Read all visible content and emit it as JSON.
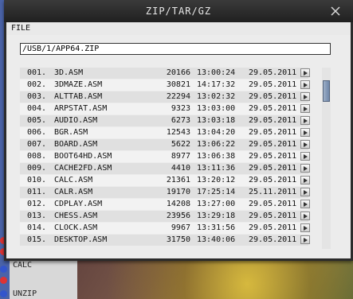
{
  "window": {
    "title": "ZIP/TAR/GZ"
  },
  "menu": {
    "file_label": "FILE"
  },
  "path": {
    "value": "/USB/1/APP64.ZIP"
  },
  "files": [
    {
      "num": "001.",
      "name": "3D.ASM",
      "size": "20166",
      "time": "13:00:24",
      "date": "29.05.2011"
    },
    {
      "num": "002.",
      "name": "3DMAZE.ASM",
      "size": "30821",
      "time": "14:17:32",
      "date": "29.05.2011"
    },
    {
      "num": "003.",
      "name": "ALTTAB.ASM",
      "size": "22294",
      "time": "13:02:32",
      "date": "29.05.2011"
    },
    {
      "num": "004.",
      "name": "ARPSTAT.ASM",
      "size": "9323",
      "time": "13:03:00",
      "date": "29.05.2011"
    },
    {
      "num": "005.",
      "name": "AUDIO.ASM",
      "size": "6273",
      "time": "13:03:18",
      "date": "29.05.2011"
    },
    {
      "num": "006.",
      "name": "BGR.ASM",
      "size": "12543",
      "time": "13:04:20",
      "date": "29.05.2011"
    },
    {
      "num": "007.",
      "name": "BOARD.ASM",
      "size": "5622",
      "time": "13:06:22",
      "date": "29.05.2011"
    },
    {
      "num": "008.",
      "name": "BOOT64HD.ASM",
      "size": "8977",
      "time": "13:06:38",
      "date": "29.05.2011"
    },
    {
      "num": "009.",
      "name": "CACHE2FD.ASM",
      "size": "4410",
      "time": "13:11:36",
      "date": "29.05.2011"
    },
    {
      "num": "010.",
      "name": "CALC.ASM",
      "size": "21361",
      "time": "13:20:12",
      "date": "29.05.2011"
    },
    {
      "num": "011.",
      "name": "CALR.ASM",
      "size": "19170",
      "time": "17:25:14",
      "date": "25.11.2011"
    },
    {
      "num": "012.",
      "name": "CDPLAY.ASM",
      "size": "14208",
      "time": "13:27:00",
      "date": "29.05.2011"
    },
    {
      "num": "013.",
      "name": "CHESS.ASM",
      "size": "23956",
      "time": "13:29:18",
      "date": "29.05.2011"
    },
    {
      "num": "014.",
      "name": "CLOCK.ASM",
      "size": "9967",
      "time": "13:31:56",
      "date": "29.05.2011"
    },
    {
      "num": "015.",
      "name": "DESKTOP.ASM",
      "size": "31750",
      "time": "13:40:06",
      "date": "29.05.2011"
    }
  ],
  "desktop": {
    "items": [
      {
        "label": "CALC"
      },
      {
        "label": "UNZIP"
      }
    ]
  },
  "colors": {
    "title_bg": "#2b2b2b",
    "client_bg": "#ececec",
    "row_alt": "#e0e0e0",
    "row_norm": "#f2f2f2",
    "scroll_thumb": "#6f86a8"
  },
  "icons": {
    "close": "close-icon",
    "row_open": "arrow-right-icon"
  }
}
